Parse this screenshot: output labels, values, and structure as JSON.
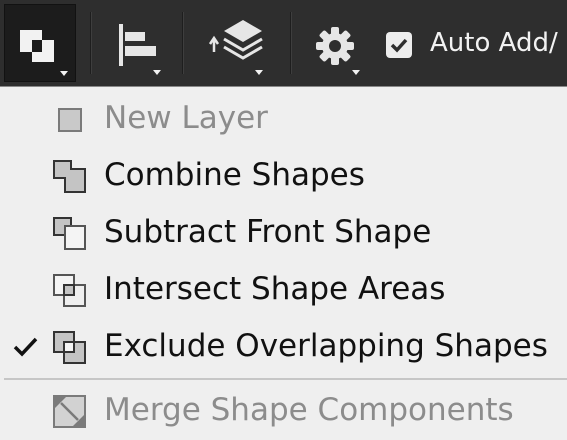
{
  "toolbar": {
    "buttons": [
      {
        "id": "path-operations",
        "icon": "path-operations-icon",
        "state": "pressed"
      },
      {
        "id": "path-alignment",
        "icon": "align-left-icon"
      },
      {
        "id": "path-arrangement",
        "icon": "layers-arrange-icon"
      },
      {
        "id": "settings",
        "icon": "gear-icon"
      }
    ],
    "auto_add": {
      "checked": true,
      "label": "Auto Add/"
    }
  },
  "menu": {
    "items": [
      {
        "label": "New Layer",
        "enabled": false,
        "checked": false,
        "icon": "new-layer-icon"
      },
      {
        "label": "Combine Shapes",
        "enabled": true,
        "checked": false,
        "icon": "combine-shapes-icon"
      },
      {
        "label": "Subtract Front Shape",
        "enabled": true,
        "checked": false,
        "icon": "subtract-front-shape-icon"
      },
      {
        "label": "Intersect Shape Areas",
        "enabled": true,
        "checked": false,
        "icon": "intersect-shape-areas-icon"
      },
      {
        "label": "Exclude Overlapping Shapes",
        "enabled": true,
        "checked": true,
        "icon": "exclude-overlapping-shapes-icon"
      },
      {
        "label": "Merge Shape Components",
        "enabled": false,
        "checked": false,
        "icon": "merge-shape-components-icon"
      }
    ]
  },
  "colors": {
    "toolbar_bg": "#2e2e2e",
    "menu_bg": "#efefef",
    "text_enabled": "#111111",
    "text_disabled": "#8c8c8c"
  }
}
